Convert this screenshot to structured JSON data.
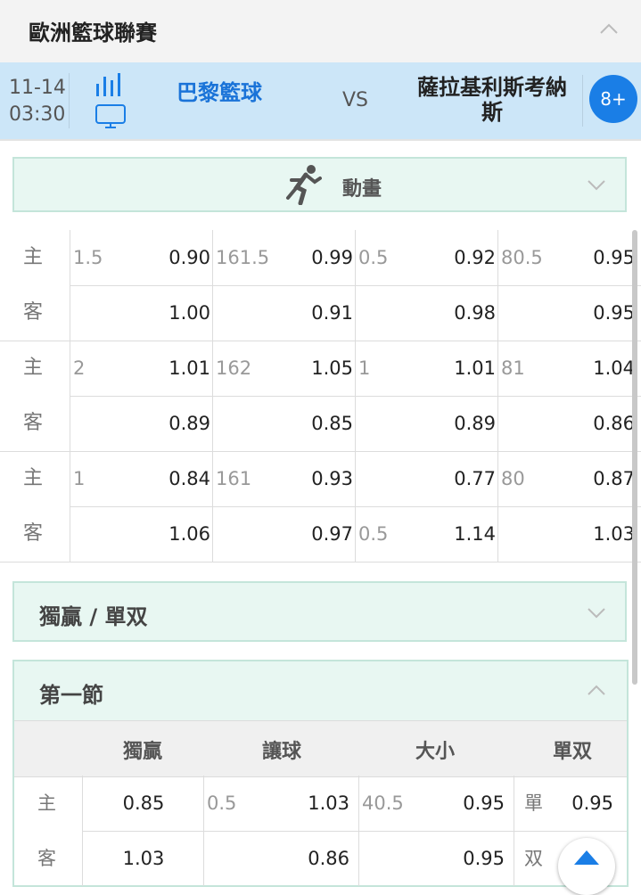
{
  "league": {
    "title": "歐洲籃球聯賽"
  },
  "match": {
    "date": "11-14",
    "time": "03:30",
    "home": "巴黎籃球",
    "vs": "VS",
    "away": "薩拉基利斯考納斯",
    "more": "8+",
    "icons": [
      "stats-bars-icon",
      "tv-icon"
    ],
    "home_color": "#1a73d8"
  },
  "animation": {
    "label": "動畫",
    "icon": "runner-icon"
  },
  "odds": {
    "groups": [
      {
        "rows": [
          {
            "side": "主",
            "c1_line": "1.5",
            "c1_val": "0.90",
            "c2_line": "161.5",
            "c2_val": "0.99",
            "c3_line": "0.5",
            "c3_val": "0.92",
            "c4_line": "80.5",
            "c4_val": "0.95"
          },
          {
            "side": "客",
            "c1_line": "",
            "c1_val": "1.00",
            "c2_line": "",
            "c2_val": "0.91",
            "c3_line": "",
            "c3_val": "0.98",
            "c4_line": "",
            "c4_val": "0.95"
          }
        ]
      },
      {
        "rows": [
          {
            "side": "主",
            "c1_line": "2",
            "c1_val": "1.01",
            "c2_line": "162",
            "c2_val": "1.05",
            "c3_line": "1",
            "c3_val": "1.01",
            "c4_line": "81",
            "c4_val": "1.04"
          },
          {
            "side": "客",
            "c1_line": "",
            "c1_val": "0.89",
            "c2_line": "",
            "c2_val": "0.85",
            "c3_line": "",
            "c3_val": "0.89",
            "c4_line": "",
            "c4_val": "0.86"
          }
        ]
      },
      {
        "rows": [
          {
            "side": "主",
            "c1_line": "1",
            "c1_val": "0.84",
            "c2_line": "161",
            "c2_val": "0.93",
            "c3_line": "",
            "c3_val": "0.77",
            "c4_line": "80",
            "c4_val": "0.87"
          },
          {
            "side": "客",
            "c1_line": "",
            "c1_val": "1.06",
            "c2_line": "",
            "c2_val": "0.97",
            "c3_line": "0.5",
            "c3_val": "1.14",
            "c4_line": "",
            "c4_val": "1.03"
          }
        ]
      }
    ]
  },
  "moneyline_section": {
    "title": "獨贏 / 單双"
  },
  "quarter1": {
    "title": "第一節",
    "columns": [
      "獨贏",
      "讓球",
      "大小",
      "單双"
    ],
    "rows": [
      {
        "side": "主",
        "win": "0.85",
        "hcp_line": "0.5",
        "hcp_val": "1.03",
        "ou_line": "40.5",
        "ou_val": "0.95",
        "oe_label": "單",
        "oe_val": "0.95"
      },
      {
        "side": "客",
        "win": "1.03",
        "hcp_line": "",
        "hcp_val": "0.86",
        "ou_line": "",
        "ou_val": "0.95",
        "oe_label": "双",
        "oe_val": "0.95"
      }
    ]
  },
  "colors": {
    "accent": "#1a7ee6",
    "section_bg": "#e8f7f2",
    "match_bg": "#cce6f8"
  }
}
